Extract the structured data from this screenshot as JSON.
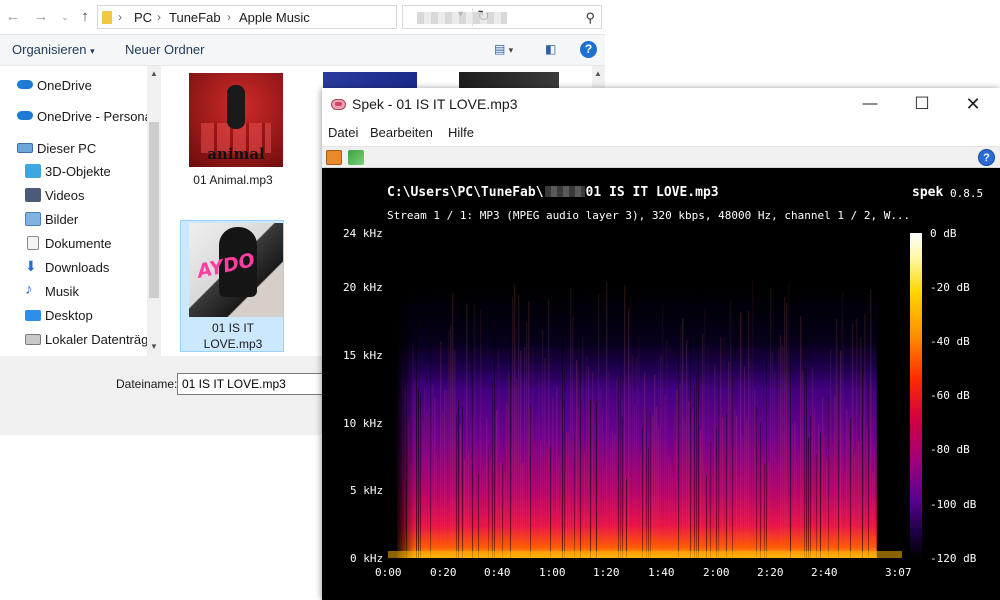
{
  "explorer": {
    "breadcrumb": [
      "PC",
      "TuneFab",
      "Apple Music"
    ],
    "toolbar": {
      "organize_label": "Organisieren",
      "new_folder_label": "Neuer Ordner"
    },
    "sidebar": {
      "items": [
        {
          "label": "OneDrive"
        },
        {
          "label": "OneDrive - Persona"
        },
        {
          "label": "Dieser PC"
        },
        {
          "label": "3D-Objekte"
        },
        {
          "label": "Videos"
        },
        {
          "label": "Bilder"
        },
        {
          "label": "Dokumente"
        },
        {
          "label": "Downloads"
        },
        {
          "label": "Musik"
        },
        {
          "label": "Desktop"
        },
        {
          "label": "Lokaler Datenträg"
        }
      ]
    },
    "files": [
      {
        "name": "01 Animal.mp3",
        "art_text": "animal"
      },
      {
        "name_line1": "01 IS IT",
        "name_line2": "LOVE.mp3",
        "art_text": "AYDO"
      }
    ],
    "filename": {
      "label": "Dateiname:",
      "value": "01 IS IT LOVE.mp3"
    }
  },
  "spek": {
    "title": "Spek - 01 IS IT LOVE.mp3",
    "menu": [
      "Datei",
      "Bearbeiten",
      "Hilfe"
    ],
    "file_path_prefix": "C:\\Users\\PC\\TuneFab\\",
    "file_path_suffix": "01 IS IT LOVE.mp3",
    "stream_info": "Stream 1 / 1: MP3 (MPEG audio layer 3), 320 kbps, 48000 Hz, channel 1 / 2, W...",
    "app_name": "spek",
    "version": "0.8.5",
    "freq_ticks": [
      "24 kHz",
      "20 kHz",
      "15 kHz",
      "10 kHz",
      "5 kHz",
      "0 kHz"
    ],
    "time_ticks": [
      "0:00",
      "0:20",
      "0:40",
      "1:00",
      "1:20",
      "1:40",
      "2:00",
      "2:20",
      "2:40",
      "3:07"
    ],
    "db_ticks": [
      "0 dB",
      "-20 dB",
      "-40 dB",
      "-60 dB",
      "-80 dB",
      "-100 dB",
      "-120 dB"
    ]
  }
}
